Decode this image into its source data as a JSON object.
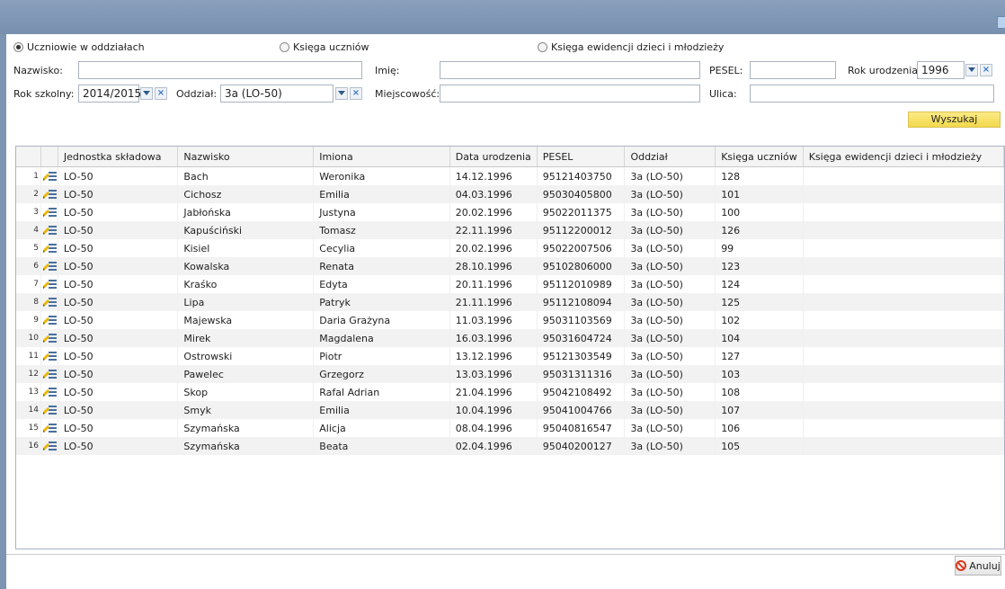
{
  "radios": {
    "uczniowie": {
      "label": "Uczniowie w oddziałach",
      "checked": true
    },
    "ksiega": {
      "label": "Księga uczniów",
      "checked": false
    },
    "ewidencja": {
      "label": "Księga ewidencji dzieci i młodzieży",
      "checked": false
    }
  },
  "filters": {
    "nazwisko_label": "Nazwisko:",
    "nazwisko_value": "",
    "imie_label": "Imię:",
    "imie_value": "",
    "pesel_label": "PESEL:",
    "pesel_value": "",
    "rok_urodzenia_label": "Rok urodzenia:",
    "rok_urodzenia_value": "1996",
    "rok_szkolny_label": "Rok szkolny:",
    "rok_szkolny_value": "2014/2015",
    "oddzial_label": "Oddział:",
    "oddzial_value": "3a (LO-50)",
    "miejscowosc_label": "Miejscowość:",
    "miejscowosc_value": "",
    "ulica_label": "Ulica:",
    "ulica_value": ""
  },
  "search_label": "Wyszukaj",
  "grid": {
    "columns": [
      "",
      "Jednostka składowa",
      "Nazwisko",
      "Imiona",
      "Data urodzenia",
      "PESEL",
      "Oddział",
      "Księga uczniów",
      "Księga ewidencji dzieci i młodzieży"
    ],
    "rows": [
      {
        "n": "1",
        "jednostka": "LO-50",
        "nazwisko": "Bach",
        "imiona": "Weronika",
        "data": "14.12.1996",
        "pesel": "95121403750",
        "oddzial": "3a (LO-50)",
        "ksiega": "128",
        "ewidencja": ""
      },
      {
        "n": "2",
        "jednostka": "LO-50",
        "nazwisko": "Cichosz",
        "imiona": "Emilia",
        "data": "04.03.1996",
        "pesel": "95030405800",
        "oddzial": "3a (LO-50)",
        "ksiega": "101",
        "ewidencja": ""
      },
      {
        "n": "3",
        "jednostka": "LO-50",
        "nazwisko": "Jabłońska",
        "imiona": "Justyna",
        "data": "20.02.1996",
        "pesel": "95022011375",
        "oddzial": "3a (LO-50)",
        "ksiega": "100",
        "ewidencja": ""
      },
      {
        "n": "4",
        "jednostka": "LO-50",
        "nazwisko": "Kapuściński",
        "imiona": "Tomasz",
        "data": "22.11.1996",
        "pesel": "95112200012",
        "oddzial": "3a (LO-50)",
        "ksiega": "126",
        "ewidencja": ""
      },
      {
        "n": "5",
        "jednostka": "LO-50",
        "nazwisko": "Kisiel",
        "imiona": "Cecylia",
        "data": "20.02.1996",
        "pesel": "95022007506",
        "oddzial": "3a (LO-50)",
        "ksiega": "99",
        "ewidencja": ""
      },
      {
        "n": "6",
        "jednostka": "LO-50",
        "nazwisko": "Kowalska",
        "imiona": "Renata",
        "data": "28.10.1996",
        "pesel": "95102806000",
        "oddzial": "3a (LO-50)",
        "ksiega": "123",
        "ewidencja": ""
      },
      {
        "n": "7",
        "jednostka": "LO-50",
        "nazwisko": "Kraśko",
        "imiona": "Edyta",
        "data": "20.11.1996",
        "pesel": "95112010989",
        "oddzial": "3a (LO-50)",
        "ksiega": "124",
        "ewidencja": ""
      },
      {
        "n": "8",
        "jednostka": "LO-50",
        "nazwisko": "Lipa",
        "imiona": "Patryk",
        "data": "21.11.1996",
        "pesel": "95112108094",
        "oddzial": "3a (LO-50)",
        "ksiega": "125",
        "ewidencja": ""
      },
      {
        "n": "9",
        "jednostka": "LO-50",
        "nazwisko": "Majewska",
        "imiona": "Daria Grażyna",
        "data": "11.03.1996",
        "pesel": "95031103569",
        "oddzial": "3a (LO-50)",
        "ksiega": "102",
        "ewidencja": ""
      },
      {
        "n": "10",
        "jednostka": "LO-50",
        "nazwisko": "Mirek",
        "imiona": "Magdalena",
        "data": "16.03.1996",
        "pesel": "95031604724",
        "oddzial": "3a (LO-50)",
        "ksiega": "104",
        "ewidencja": ""
      },
      {
        "n": "11",
        "jednostka": "LO-50",
        "nazwisko": "Ostrowski",
        "imiona": "Piotr",
        "data": "13.12.1996",
        "pesel": "95121303549",
        "oddzial": "3a (LO-50)",
        "ksiega": "127",
        "ewidencja": ""
      },
      {
        "n": "12",
        "jednostka": "LO-50",
        "nazwisko": "Pawelec",
        "imiona": "Grzegorz",
        "data": "13.03.1996",
        "pesel": "95031311316",
        "oddzial": "3a (LO-50)",
        "ksiega": "103",
        "ewidencja": ""
      },
      {
        "n": "13",
        "jednostka": "LO-50",
        "nazwisko": "Skop",
        "imiona": "Rafal Adrian",
        "data": "21.04.1996",
        "pesel": "95042108492",
        "oddzial": "3a (LO-50)",
        "ksiega": "108",
        "ewidencja": ""
      },
      {
        "n": "14",
        "jednostka": "LO-50",
        "nazwisko": "Smyk",
        "imiona": "Emilia",
        "data": "10.04.1996",
        "pesel": "95041004766",
        "oddzial": "3a (LO-50)",
        "ksiega": "107",
        "ewidencja": ""
      },
      {
        "n": "15",
        "jednostka": "LO-50",
        "nazwisko": "Szymańska",
        "imiona": "Alicja",
        "data": "08.04.1996",
        "pesel": "95040816547",
        "oddzial": "3a (LO-50)",
        "ksiega": "106",
        "ewidencja": ""
      },
      {
        "n": "16",
        "jednostka": "LO-50",
        "nazwisko": "Szymańska",
        "imiona": "Beata",
        "data": "02.04.1996",
        "pesel": "95040200127",
        "oddzial": "3a (LO-50)",
        "ksiega": "105",
        "ewidencja": ""
      }
    ]
  },
  "cancel_label": "Anuluj",
  "icons": {
    "row": "edit-list-icon",
    "cancel": "no-entry-icon",
    "dropdown": "chevron-down-icon",
    "clear": "clear-icon"
  },
  "colors": {
    "frame": "#7d95b3",
    "search_button": "#f2d84a",
    "cancel_icon": "#d9391c"
  }
}
